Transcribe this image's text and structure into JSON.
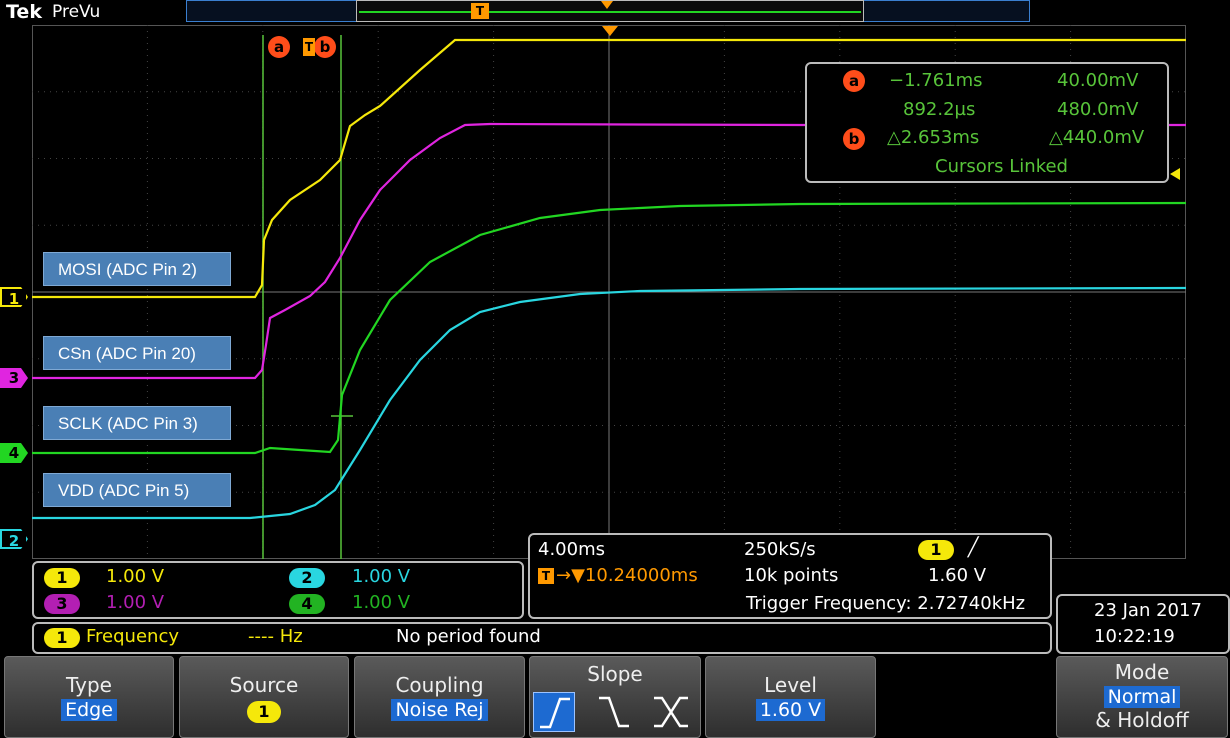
{
  "brand": {
    "tek": "Tek",
    "mode": "PreVu"
  },
  "colors": {
    "ch1": "#f5e80a",
    "ch2": "#29d6e0",
    "ch3": "#e025e0",
    "ch4": "#22d622",
    "cursor": "#58c43a",
    "accent": "#ff4d1a",
    "trigger": "#ff9900"
  },
  "cursor_markers": {
    "a": "a",
    "b": "b",
    "trigger": "T"
  },
  "channel_markers": {
    "ch1": "1",
    "ch2": "2",
    "ch3": "3",
    "ch4": "4"
  },
  "labels": {
    "mosi": "MOSI (ADC Pin 2)",
    "csn": "CSn (ADC Pin 20)",
    "sclk": "SCLK (ADC Pin 3)",
    "vdd": "VDD (ADC Pin 5)"
  },
  "cursor_readout": {
    "a_time": "−1.761ms",
    "a_volt": "40.00mV",
    "b_time": "892.2µs",
    "b_volt": "480.0mV",
    "delta_time": "△2.653ms",
    "delta_volt": "△440.0mV",
    "linked": "Cursors Linked"
  },
  "channels": [
    {
      "num": "1",
      "scale": "1.00 V",
      "color": "#f5e80a"
    },
    {
      "num": "2",
      "scale": "1.00 V",
      "color": "#29d6e0"
    },
    {
      "num": "3",
      "scale": "1.00 V",
      "color": "#e025e0"
    },
    {
      "num": "4",
      "scale": "1.00 V",
      "color": "#22d622"
    }
  ],
  "horizontal": {
    "timebase": "4.00ms",
    "sample_rate": "250kS/s",
    "trigger_channel": "1",
    "trigger_slope_icon": "rising-edge-icon",
    "delay": "→▼10.24000ms",
    "record_length": "10k points",
    "trigger_level": "1.60 V",
    "trigger_freq": "Trigger Frequency: 2.72740kHz"
  },
  "measurement": {
    "channel": "1",
    "name": "Frequency",
    "value": "---- Hz",
    "message": "No period found"
  },
  "datetime": {
    "date": "23 Jan  2017",
    "time": "10:22:19"
  },
  "menu": {
    "type": {
      "title": "Type",
      "value": "Edge"
    },
    "source": {
      "title": "Source",
      "value": "1"
    },
    "coupling": {
      "title": "Coupling",
      "value": "Noise Rej"
    },
    "slope": {
      "title": "Slope",
      "options": [
        "rising-slope-icon",
        "falling-slope-icon",
        "either-slope-icon"
      ],
      "selected": 0
    },
    "level": {
      "title": "Level",
      "value": "1.60 V"
    },
    "mode": {
      "title": "Mode",
      "value": "Normal",
      "extra": "& Holdoff"
    }
  }
}
